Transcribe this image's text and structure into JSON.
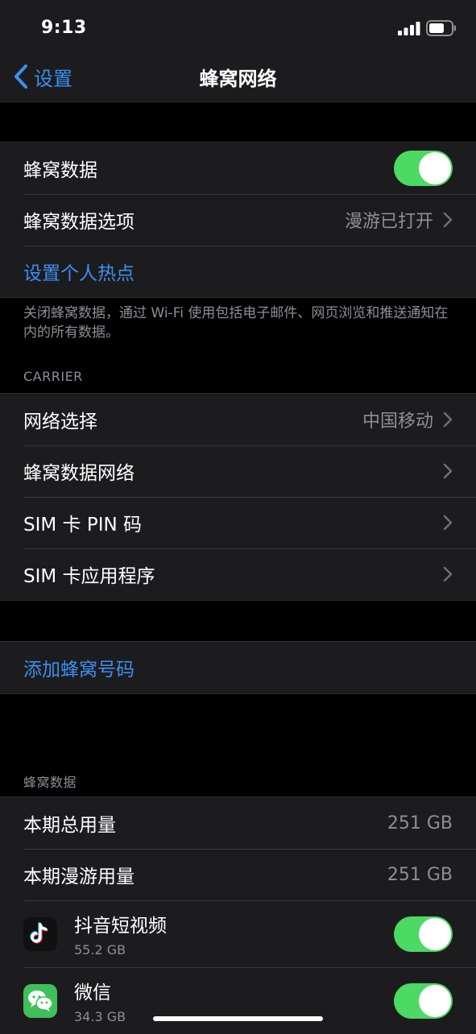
{
  "status": {
    "time": "9:13"
  },
  "nav": {
    "back_label": "设置",
    "title": "蜂窝网络"
  },
  "group1": {
    "cellular_data": "蜂窝数据",
    "cellular_options": "蜂窝数据选项",
    "cellular_options_value": "漫游已打开",
    "hotspot": "设置个人热点"
  },
  "footer_note": "关闭蜂窝数据，通过 Wi-Fi 使用包括电子邮件、网页浏览和推送通知在内的所有数据。",
  "carrier": {
    "header": "CARRIER",
    "network_selection": "网络选择",
    "network_selection_value": "中国移动",
    "cellular_network": "蜂窝数据网络",
    "sim_pin": "SIM 卡 PIN 码",
    "sim_apps": "SIM 卡应用程序"
  },
  "add_plan": "添加蜂窝号码",
  "usage": {
    "header": "蜂窝数据",
    "total_label": "本期总用量",
    "total_value": "251 GB",
    "roaming_label": "本期漫游用量",
    "roaming_value": "251 GB",
    "apps": [
      {
        "name": "抖音短视频",
        "size": "55.2 GB",
        "icon": "tiktok-icon"
      },
      {
        "name": "微信",
        "size": "34.3 GB",
        "icon": "wechat-icon"
      }
    ]
  },
  "colors": {
    "accent": "#3d8ef0",
    "toggle_on": "#4cd964",
    "background": "#000000",
    "cell": "#1c1c1e",
    "secondary_text": "#8e8e93"
  }
}
